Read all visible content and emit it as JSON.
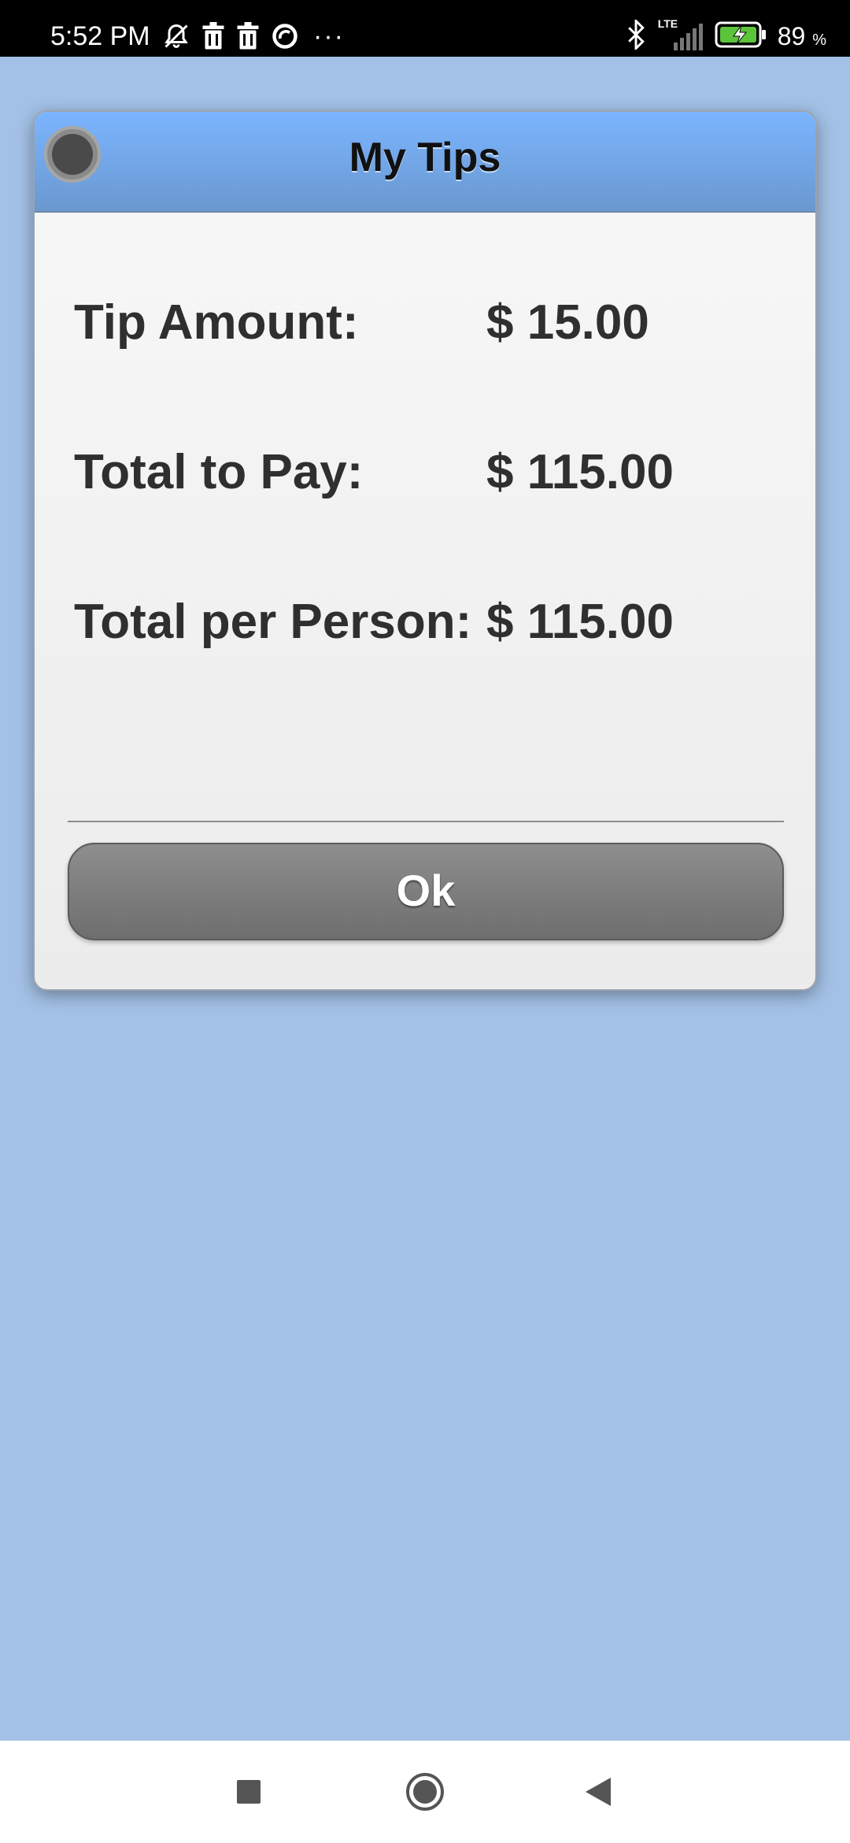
{
  "status_bar": {
    "time": "5:52 PM",
    "left_icons": [
      "notifications-off-icon",
      "trash-icon",
      "trash-icon",
      "sync-icon"
    ],
    "overflow": "···",
    "network": "LTE",
    "battery_percent": "89",
    "battery_unit": "%"
  },
  "dialog": {
    "title": "My Tips",
    "rows": [
      {
        "label": "Tip Amount:",
        "value": "$ 15.00"
      },
      {
        "label": "Total to Pay:",
        "value": "$ 115.00"
      },
      {
        "label": "Total per Person:",
        "value": "$ 115.00"
      }
    ],
    "ok_label": "Ok"
  },
  "colors": {
    "background": "#a3c1e6",
    "header_top": "#7bb5ff",
    "header_bottom": "#6a98cf",
    "button": "#7e7e7e"
  },
  "nav_bar": {
    "buttons": [
      "recents-icon",
      "home-icon",
      "back-icon"
    ]
  }
}
